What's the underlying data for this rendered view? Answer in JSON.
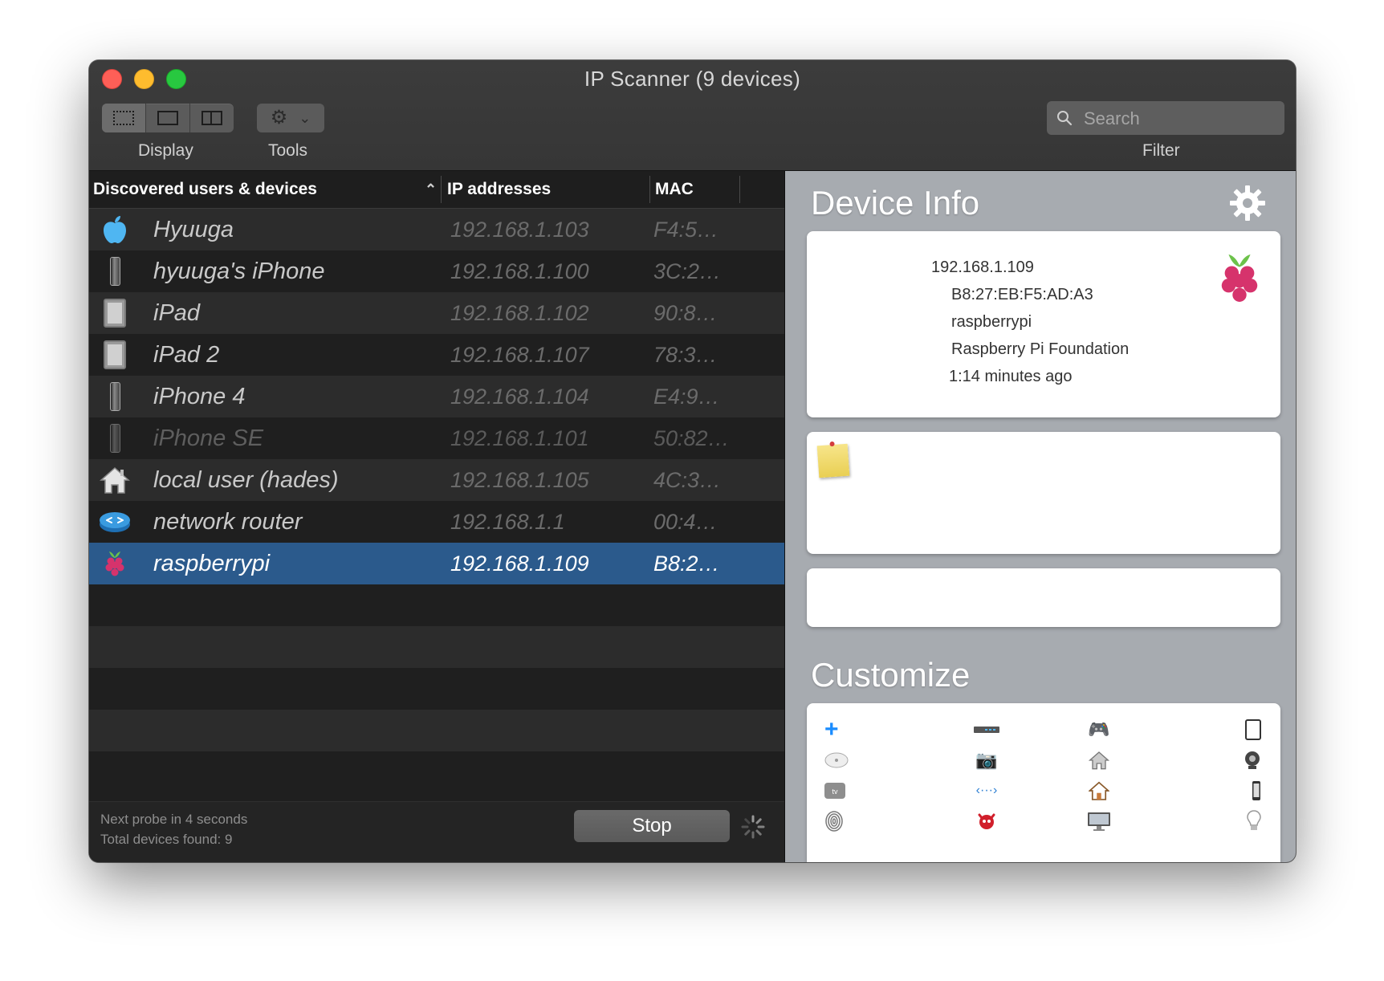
{
  "window": {
    "title": "IP Scanner (9 devices)"
  },
  "toolbar": {
    "display_label": "Display",
    "tools_label": "Tools",
    "filter_label": "Filter",
    "search_placeholder": "Search"
  },
  "table": {
    "columns": [
      "Discovered users & devices",
      "IP addresses",
      "MAC"
    ],
    "rows": [
      {
        "name": "Hyuuga",
        "ip": "192.168.1.103",
        "mac": "F4:5…",
        "icon": "apple-icon"
      },
      {
        "name": "hyuuga's iPhone",
        "ip": "192.168.1.100",
        "mac": "3C:2…",
        "icon": "iphone-icon"
      },
      {
        "name": "iPad",
        "ip": "192.168.1.102",
        "mac": "90:8…",
        "icon": "ipad-icon"
      },
      {
        "name": "iPad 2",
        "ip": "192.168.1.107",
        "mac": "78:3…",
        "icon": "ipad-icon"
      },
      {
        "name": "iPhone 4",
        "ip": "192.168.1.104",
        "mac": "E4:9…",
        "icon": "iphone-icon"
      },
      {
        "name": "iPhone SE",
        "ip": "192.168.1.101",
        "mac": "50:82…",
        "icon": "iphone-icon"
      },
      {
        "name": "local user (hades)",
        "ip": "192.168.1.105",
        "mac": "4C:3…",
        "icon": "house-icon"
      },
      {
        "name": "network router",
        "ip": "192.168.1.1",
        "mac": "00:4…",
        "icon": "router-icon"
      },
      {
        "name": "raspberrypi",
        "ip": "192.168.1.109",
        "mac": "B8:2…",
        "icon": "raspberry-pi-icon"
      }
    ]
  },
  "footer": {
    "next_probe": "Next probe in 4 seconds",
    "total_found": "Total devices found: 9",
    "stop_label": "Stop"
  },
  "device_info": {
    "heading": "Device Info",
    "ip": "192.168.1.109",
    "mac": "B8:27:EB:F5:AD:A3",
    "hostname": "raspberrypi",
    "vendor": "Raspberry Pi Foundation",
    "last_seen": "1:14 minutes ago"
  },
  "customize": {
    "heading": "Customize",
    "icons": [
      "add-icon",
      "network-switch-icon",
      "gamepad-icon",
      "tablet-icon",
      "airport-icon",
      "camera-icon",
      "home-icon",
      "webcam-icon",
      "apple-tv-icon",
      "network-arrows-icon",
      "house-outline-icon",
      "phone-icon",
      "fingerprint-icon",
      "freebsd-daemon-icon",
      "monitor-icon",
      "lightbulb-icon"
    ]
  },
  "colors": {
    "selected_row": "#2b5a8c",
    "right_panel": "#a7abb0",
    "accent_plus": "#1a8cff"
  }
}
